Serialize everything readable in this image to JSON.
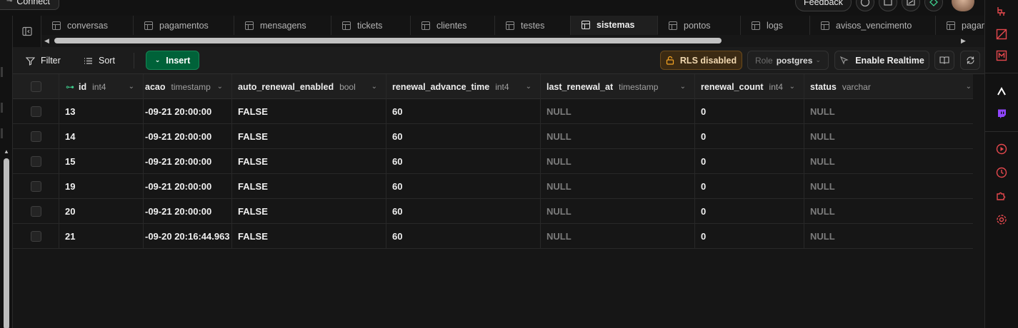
{
  "topbar": {
    "connect_label": "Connect",
    "feedback_label": "Feedback"
  },
  "tabs": [
    {
      "label": "conversas",
      "active": false
    },
    {
      "label": "pagamentos",
      "active": false
    },
    {
      "label": "mensagens",
      "active": false
    },
    {
      "label": "tickets",
      "active": false
    },
    {
      "label": "clientes",
      "active": false
    },
    {
      "label": "testes",
      "active": false
    },
    {
      "label": "sistemas",
      "active": true
    },
    {
      "label": "pontos",
      "active": false
    },
    {
      "label": "logs",
      "active": false
    },
    {
      "label": "avisos_vencimento",
      "active": false
    },
    {
      "label": "pagam",
      "active": false
    }
  ],
  "toolbar": {
    "filter_label": "Filter",
    "sort_label": "Sort",
    "insert_label": "Insert",
    "rls_label": "RLS disabled",
    "role_label": "Role",
    "role_value": "postgres",
    "realtime_label": "Enable Realtime"
  },
  "columns": [
    {
      "name": "id",
      "type": "int4",
      "primary_key": true
    },
    {
      "name": "acao",
      "type": "timestamp"
    },
    {
      "name": "auto_renewal_enabled",
      "type": "bool"
    },
    {
      "name": "renewal_advance_time",
      "type": "int4"
    },
    {
      "name": "last_renewal_at",
      "type": "timestamp"
    },
    {
      "name": "renewal_count",
      "type": "int4"
    },
    {
      "name": "status",
      "type": "varchar"
    }
  ],
  "rows": [
    [
      "13",
      "-09-21 20:00:00",
      "FALSE",
      "60",
      "NULL",
      "0",
      "NULL"
    ],
    [
      "14",
      "-09-21 20:00:00",
      "FALSE",
      "60",
      "NULL",
      "0",
      "NULL"
    ],
    [
      "15",
      "-09-21 20:00:00",
      "FALSE",
      "60",
      "NULL",
      "0",
      "NULL"
    ],
    [
      "19",
      "-09-21 20:00:00",
      "FALSE",
      "60",
      "NULL",
      "0",
      "NULL"
    ],
    [
      "20",
      "-09-21 20:00:00",
      "FALSE",
      "60",
      "NULL",
      "0",
      "NULL"
    ],
    [
      "21",
      "-09-20 20:16:44.963",
      "FALSE",
      "60",
      "NULL",
      "0",
      "NULL"
    ]
  ],
  "colors": {
    "accent_green": "#3ecf8e",
    "insert_bg": "#006239",
    "rls_bg": "#3b2a13",
    "dock_icon": "#e5484d"
  },
  "dock_icons": [
    "pipeline-icon",
    "no-image-icon",
    "gmail-icon",
    "vercel-icon",
    "twitch-icon",
    "play-circle-icon",
    "clock-icon",
    "puzzle-icon",
    "settings-gear-icon"
  ]
}
